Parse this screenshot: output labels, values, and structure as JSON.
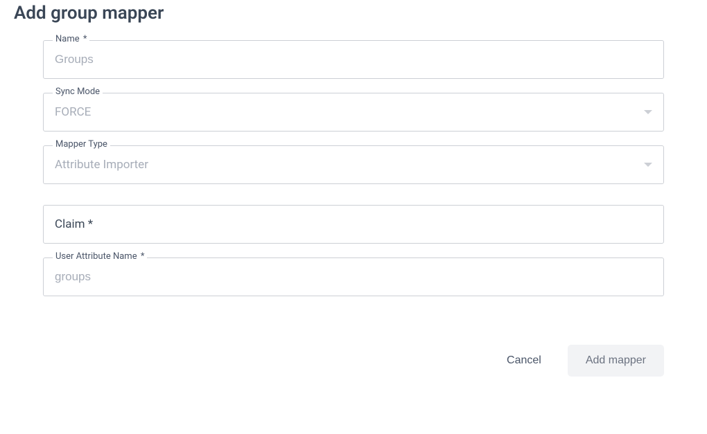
{
  "title": "Add group mapper",
  "fields": {
    "name": {
      "label": "Name",
      "required_marker": "*",
      "placeholder": "Groups",
      "value": ""
    },
    "sync_mode": {
      "label": "Sync Mode",
      "value": "FORCE"
    },
    "mapper_type": {
      "label": "Mapper Type",
      "value": "Attribute Importer"
    },
    "claim": {
      "label": "Claim *",
      "value": ""
    },
    "user_attribute_name": {
      "label": "User Attribute Name",
      "required_marker": "*",
      "placeholder": "groups",
      "value": ""
    }
  },
  "actions": {
    "cancel": "Cancel",
    "submit": "Add mapper"
  }
}
